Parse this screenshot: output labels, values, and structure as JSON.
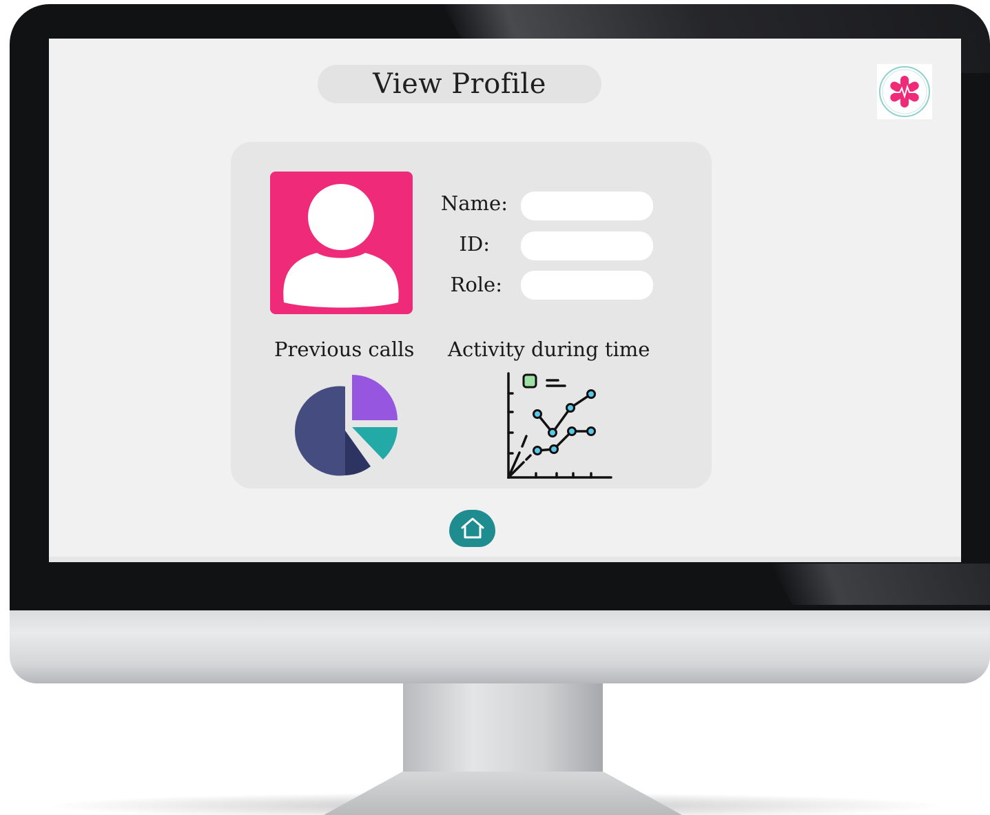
{
  "header": {
    "title": "View Profile"
  },
  "logo": {
    "icon": "medical-star-icon",
    "color": "#ef2a78"
  },
  "profile": {
    "avatar_icon": "user-avatar-icon",
    "avatar_color": "#ef2a78",
    "fields": [
      {
        "label": "Name:",
        "value": ""
      },
      {
        "label": "ID:",
        "value": ""
      },
      {
        "label": "Role:",
        "value": ""
      }
    ]
  },
  "sections": {
    "previous_calls": {
      "label": "Previous calls",
      "icon": "pie-chart-icon"
    },
    "activity": {
      "label": "Activity during time",
      "icon": "line-chart-icon"
    }
  },
  "nav": {
    "home_icon": "home-icon",
    "accent": "#1f8c90"
  },
  "colors": {
    "screen_bg": "#f1f1f1",
    "card_bg": "#e6e6e6",
    "pill_bg": "#e3e3e3",
    "pie_purple": "#9656e0",
    "pie_teal": "#24aaa6",
    "pie_navy": "#454d80",
    "pie_dark": "#2e3461"
  }
}
